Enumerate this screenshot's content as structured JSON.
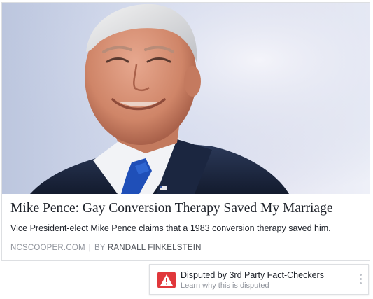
{
  "article": {
    "image_alt": "Mike Pence photo",
    "headline": "Mike Pence: Gay Conversion Therapy Saved My Marriage",
    "description": "Vice President-elect Mike Pence claims that a 1983 conversion therapy saved him.",
    "source": "NCSCOOPER.COM",
    "separator": "|",
    "byline_prefix": "BY",
    "author": "RANDALL FINKELSTEIN"
  },
  "dispute": {
    "title": "Disputed by 3rd Party Fact-Checkers",
    "subtitle": "Learn why this is disputed",
    "icon": "warning-triangle-icon",
    "menu_icon": "more-vertical-icon",
    "colors": {
      "badge": "#e0373b"
    }
  }
}
